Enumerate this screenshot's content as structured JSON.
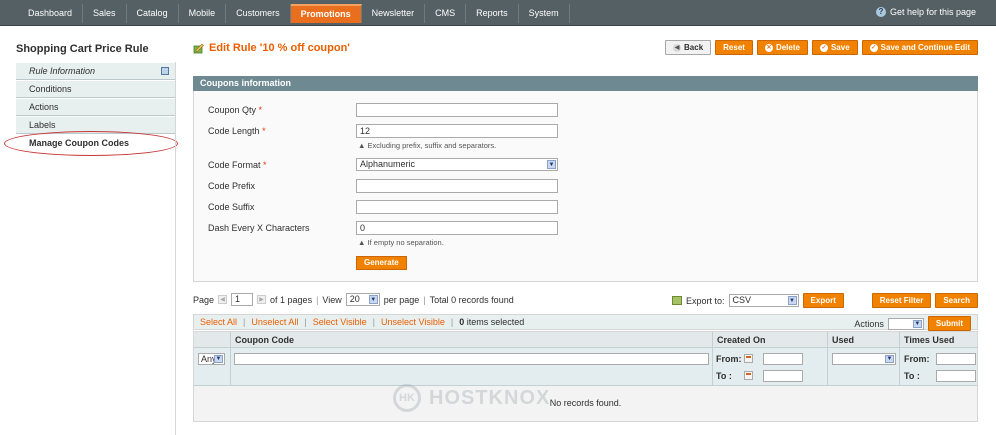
{
  "nav": {
    "items": [
      "Dashboard",
      "Sales",
      "Catalog",
      "Mobile",
      "Customers",
      "Promotions",
      "Newsletter",
      "CMS",
      "Reports",
      "System"
    ],
    "active_index": 5,
    "help": "Get help for this page"
  },
  "sidebar": {
    "title": "Shopping Cart Price Rule",
    "items": [
      "Rule Information",
      "Conditions",
      "Actions",
      "Labels",
      "Manage Coupon Codes"
    ]
  },
  "header": {
    "title": "Edit Rule '10 % off coupon'",
    "buttons": {
      "back": "Back",
      "reset": "Reset",
      "delete": "Delete",
      "save": "Save",
      "save_continue": "Save and Continue Edit"
    }
  },
  "coupons": {
    "heading": "Coupons information",
    "qty_label": "Coupon Qty",
    "qty_value": "",
    "length_label": "Code Length",
    "length_value": "12",
    "length_note": "Excluding prefix, suffix and separators.",
    "format_label": "Code Format",
    "format_value": "Alphanumeric",
    "prefix_label": "Code Prefix",
    "prefix_value": "",
    "suffix_label": "Code Suffix",
    "suffix_value": "",
    "dash_label": "Dash Every X Characters",
    "dash_value": "0",
    "dash_note": "If empty no separation.",
    "required_mark": "*",
    "generate": "Generate"
  },
  "pager": {
    "page_label": "Page",
    "page_value": "1",
    "of_pages": "of 1 pages",
    "view_label": "View",
    "view_value": "20",
    "per_page": "per page",
    "records": "Total 0 records found",
    "export_label": "Export to:",
    "export_value": "CSV",
    "export_btn": "Export",
    "reset_filter": "Reset Filter",
    "search": "Search"
  },
  "massaction": {
    "select_all": "Select All",
    "unselect_all": "Unselect All",
    "select_visible": "Select Visible",
    "unselect_visible": "Unselect Visible",
    "selected_count": "0",
    "selected_text": "items selected",
    "actions_label": "Actions",
    "submit": "Submit"
  },
  "grid": {
    "headers": [
      "Coupon Code",
      "Created On",
      "Used",
      "Times Used"
    ],
    "any": "Any",
    "from": "From:",
    "to": "To :",
    "empty": "No records found."
  },
  "watermark": {
    "logo": "HK",
    "text": "HOSTKNOX"
  }
}
